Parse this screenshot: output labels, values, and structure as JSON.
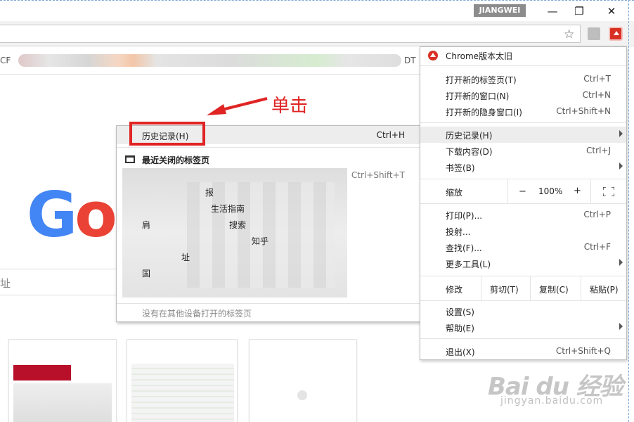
{
  "window": {
    "profile_name": "JIANGWEI",
    "minimize_glyph": "—",
    "restore_glyph": "❐",
    "close_glyph": "✕"
  },
  "toolbar": {
    "star_icon": "☆",
    "icons": [
      "star-icon",
      "pdf-extension-icon",
      "chrome-update-menu-icon"
    ]
  },
  "bookmarks_bar": {
    "left_text": "CF",
    "right_text": "DT"
  },
  "newtab": {
    "logo_letters": [
      "G",
      "o",
      "o"
    ],
    "search_placeholder": "址"
  },
  "annotation": {
    "text": "单击",
    "color": "#e02424"
  },
  "history_submenu": {
    "header_label": "历史记录(H)",
    "header_shortcut": "Ctrl+H",
    "recently_closed": "最近关闭的标签页",
    "reopen_shortcut": "Ctrl+Shift+T",
    "items": [
      "报",
      "生活指南",
      "肩",
      "搜索",
      "知乎",
      "址",
      "国"
    ],
    "other_devices": "没有在其他设备打开的标签页"
  },
  "chrome_menu": {
    "update_label": "Chrome版本太旧",
    "new_tab": {
      "label": "打开新的标签页(T)",
      "shortcut": "Ctrl+T"
    },
    "new_window": {
      "label": "打开新的窗口(N)",
      "shortcut": "Ctrl+N"
    },
    "incognito": {
      "label": "打开新的隐身窗口(I)",
      "shortcut": "Ctrl+Shift+N"
    },
    "history": {
      "label": "历史记录(H)"
    },
    "downloads": {
      "label": "下载内容(D)",
      "shortcut": "Ctrl+J"
    },
    "bookmarks": {
      "label": "书签(B)"
    },
    "zoom": {
      "label": "缩放",
      "minus": "−",
      "value": "100%",
      "plus": "+"
    },
    "print": {
      "label": "打印(P)...",
      "shortcut": "Ctrl+P"
    },
    "cast": {
      "label": "投射..."
    },
    "find": {
      "label": "查找(F)...",
      "shortcut": "Ctrl+F"
    },
    "more_tools": {
      "label": "更多工具(L)"
    },
    "edit": {
      "label": "修改",
      "cut": "剪切(T)",
      "copy": "复制(C)",
      "paste": "粘贴(P)"
    },
    "settings": {
      "label": "设置(S)"
    },
    "help": {
      "label": "帮助(E)"
    },
    "exit": {
      "label": "退出(X)",
      "shortcut": "Ctrl+Shift+Q"
    }
  },
  "watermark": {
    "brand": "Bai du 经验",
    "url": "jingyan.baidu.com"
  }
}
